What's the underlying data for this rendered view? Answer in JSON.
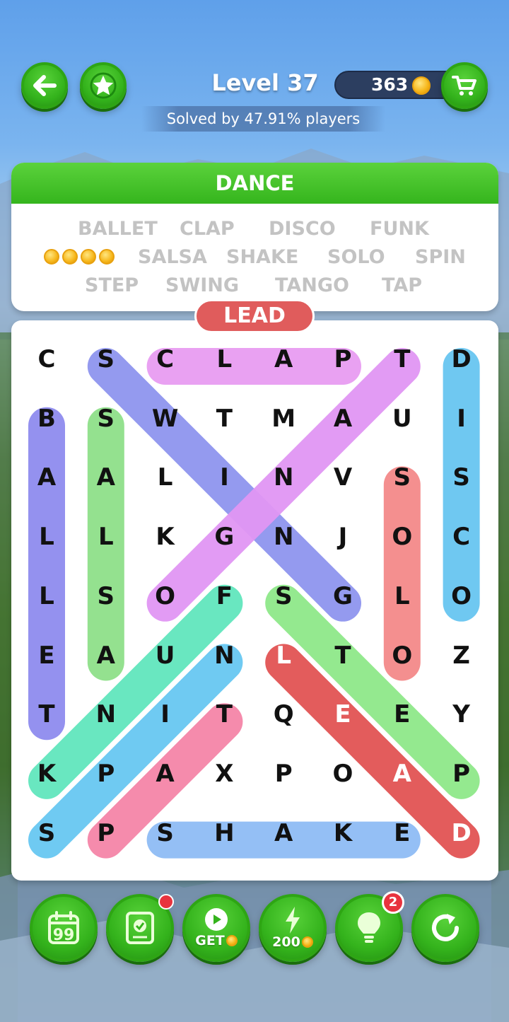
{
  "header": {
    "level_title": "Level 37",
    "solved_text": "Solved by 47.91% players",
    "coins": "363"
  },
  "category": {
    "title": "DANCE",
    "words": [
      "BALLET",
      "CLAP",
      "DISCO",
      "FUNK",
      "SALSA",
      "SHAKE",
      "SOLO",
      "SPIN",
      "STEP",
      "SWING",
      "TANGO",
      "TAP"
    ],
    "coin_reward_count": 4
  },
  "current_word": "LEAD",
  "grid": [
    [
      "C",
      "S",
      "C",
      "L",
      "A",
      "P",
      "T",
      "D"
    ],
    [
      "B",
      "S",
      "W",
      "T",
      "M",
      "A",
      "U",
      "I"
    ],
    [
      "A",
      "A",
      "L",
      "I",
      "N",
      "V",
      "S",
      "S"
    ],
    [
      "L",
      "L",
      "K",
      "G",
      "N",
      "J",
      "O",
      "C"
    ],
    [
      "L",
      "S",
      "O",
      "F",
      "S",
      "G",
      "L",
      "O"
    ],
    [
      "E",
      "A",
      "U",
      "N",
      "L",
      "T",
      "O",
      "Z"
    ],
    [
      "T",
      "N",
      "I",
      "T",
      "Q",
      "E",
      "E",
      "Y"
    ],
    [
      "K",
      "P",
      "A",
      "X",
      "P",
      "O",
      "A",
      "P"
    ],
    [
      "S",
      "P",
      "S",
      "H",
      "A",
      "K",
      "E",
      "D"
    ]
  ],
  "highlights": [
    {
      "word": "CLAP",
      "color": "#e89cf2",
      "from": [
        0,
        2
      ],
      "to": [
        0,
        5
      ]
    },
    {
      "word": "SWING",
      "color": "#8f95ef",
      "from": [
        0,
        1
      ],
      "to": [
        4,
        5
      ]
    },
    {
      "word": "TANGO",
      "color": "#e196f4",
      "from": [
        0,
        6
      ],
      "to": [
        4,
        2
      ]
    },
    {
      "word": "DISCO",
      "color": "#68c6f1",
      "from": [
        0,
        7
      ],
      "to": [
        4,
        7
      ]
    },
    {
      "word": "BALLET",
      "color": "#8f8cef",
      "from": [
        1,
        0
      ],
      "to": [
        6,
        0
      ]
    },
    {
      "word": "SALSA",
      "color": "#8fe08a",
      "from": [
        1,
        1
      ],
      "to": [
        5,
        1
      ]
    },
    {
      "word": "SOLO",
      "color": "#f48a8a",
      "from": [
        2,
        6
      ],
      "to": [
        5,
        6
      ]
    },
    {
      "word": "FUNK",
      "color": "#62e6bd",
      "from": [
        4,
        3
      ],
      "to": [
        7,
        0
      ]
    },
    {
      "word": "STEP",
      "color": "#8fe88a",
      "from": [
        4,
        4
      ],
      "to": [
        7,
        7
      ]
    },
    {
      "word": "SPIN",
      "color": "#68c8f2",
      "from": [
        8,
        0
      ],
      "to": [
        5,
        3
      ]
    },
    {
      "word": "TAP",
      "color": "#f585a8",
      "from": [
        6,
        3
      ],
      "to": [
        8,
        1
      ]
    },
    {
      "word": "SHAKE",
      "color": "#8fbcf5",
      "from": [
        8,
        2
      ],
      "to": [
        8,
        6
      ]
    },
    {
      "word": "LEAD",
      "color": "#e35c5c",
      "from": [
        5,
        4
      ],
      "to": [
        8,
        7
      ]
    }
  ],
  "toolbar": {
    "daily_icon": "calendar-quote-icon",
    "notebook_icon": "checklist-book-icon",
    "get_label": "GET",
    "power_value": "200",
    "hint_badge": "2",
    "restart_icon": "restart-icon"
  },
  "colors": {
    "accent_green": "#35b51d",
    "lead_red": "#e05c5c",
    "word_gray": "#c3c3c3",
    "coin_gold": "#f6b61a"
  }
}
